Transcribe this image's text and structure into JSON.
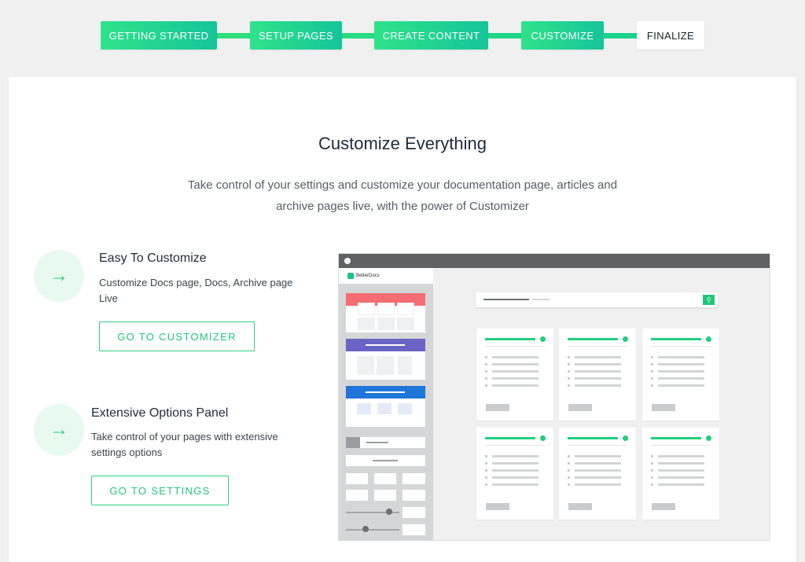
{
  "stepper": {
    "steps": [
      {
        "label": "GETTING STARTED",
        "state": "completed"
      },
      {
        "label": "SETUP PAGES",
        "state": "completed"
      },
      {
        "label": "CREATE CONTENT",
        "state": "completed"
      },
      {
        "label": "CUSTOMIZE",
        "state": "active"
      },
      {
        "label": "FINALIZE",
        "state": "pending"
      }
    ]
  },
  "main": {
    "title": "Customize Everything",
    "subtitle_line1": "Take control of your settings and customize your documentation page, articles and",
    "subtitle_line2": "archive pages live, with the power of Customizer"
  },
  "features": [
    {
      "title": "Easy To Customize",
      "desc_line1": "Customize Docs page, Docs, Archive page",
      "desc_line2": "Live",
      "button": "GO TO CUSTOMIZER",
      "icon": "arrow-right-icon"
    },
    {
      "title": "Extensive Options Panel",
      "desc_line1": "Take control of your pages with extensive",
      "desc_line2": "settings options",
      "button": "GO TO SETTINGS",
      "icon": "arrow-right-icon"
    }
  ],
  "preview": {
    "brand": "BetterDocs"
  },
  "colors": {
    "accent": "#22c77b",
    "accent_light": "#e8f9ef",
    "background": "#f0f0f1"
  }
}
